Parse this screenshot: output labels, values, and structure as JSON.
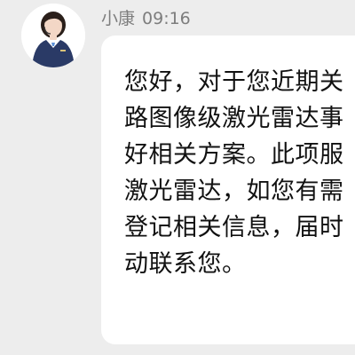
{
  "message": {
    "sender": "小康",
    "time": "09:16",
    "lines": [
      "您好，对于您近期关",
      "路图像级激光雷达事",
      "好相关方案。此项服",
      "激光雷达，如您有需",
      "登记相关信息，届时",
      "动联系您。"
    ]
  },
  "avatar": {
    "icon": "customer-service-agent-avatar",
    "colors": {
      "uniform": "#2a3a66",
      "shirt": "#ffffff",
      "tie": "#5b8fd6",
      "hair": "#2a1f1a",
      "skin": "#f3d7c6"
    }
  },
  "colors": {
    "background": "#ededed",
    "bubble": "#ffffff",
    "meta_text": "#7d7d7d",
    "message_text": "#111111"
  }
}
